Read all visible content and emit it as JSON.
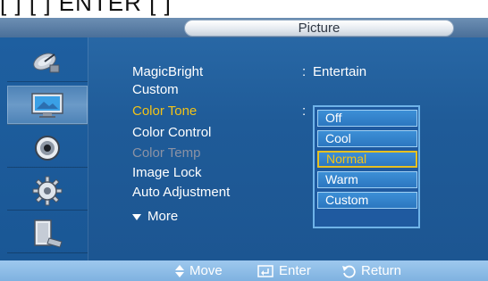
{
  "top_strip_text": "[ ] [ ] ENTER [ ]",
  "title": "Picture",
  "sidebar": {
    "items": [
      {
        "icon": "satellite-dish-icon"
      },
      {
        "icon": "picture-monitor-icon",
        "active": true
      },
      {
        "icon": "speaker-icon"
      },
      {
        "icon": "gear-settings-icon"
      },
      {
        "icon": "monitor-stand-icon"
      }
    ]
  },
  "menu": {
    "items": [
      {
        "label": "MagicBright",
        "value": "Entertain"
      },
      {
        "label": "Custom"
      },
      {
        "label": "Color Tone",
        "highlight": true
      },
      {
        "label": "Color Control"
      },
      {
        "label": "Color Temp",
        "disabled": true
      },
      {
        "label": "Image Lock"
      },
      {
        "label": "Auto Adjustment"
      },
      {
        "label": "More"
      }
    ],
    "colon": ":"
  },
  "dropdown": {
    "options": [
      "Off",
      "Cool",
      "Normal",
      "Warm",
      "Custom"
    ],
    "selected": "Normal"
  },
  "footer": {
    "move": "Move",
    "enter": "Enter",
    "return": "Return"
  },
  "colors": {
    "highlight": "#f2c318",
    "panel": "#1f5b98",
    "footer": "#8fbde8"
  }
}
